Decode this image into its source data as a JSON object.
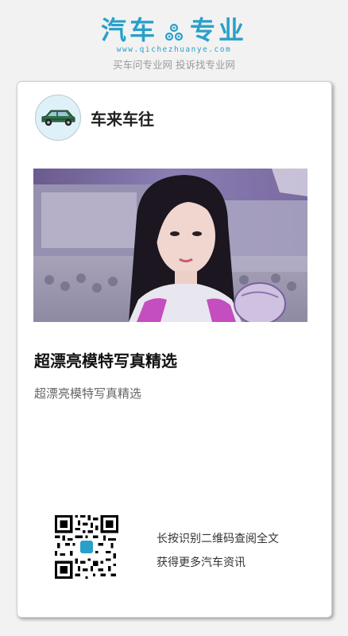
{
  "brand": {
    "title_left": "汽车",
    "title_right": "专业",
    "url": "www.qichezhuanye.com",
    "slogan": "买车问专业网 投诉找专业网",
    "color": "#2aa0c8"
  },
  "author": {
    "name": "车来车往",
    "avatar_icon": "car-icon"
  },
  "article": {
    "image_icon": "model-photo",
    "title": "超漂亮模特写真精选",
    "summary": "超漂亮模特写真精选"
  },
  "qr": {
    "icon": "qr-code-icon",
    "line1": "长按识别二维码查阅全文",
    "line2": "获得更多汽车资讯"
  }
}
